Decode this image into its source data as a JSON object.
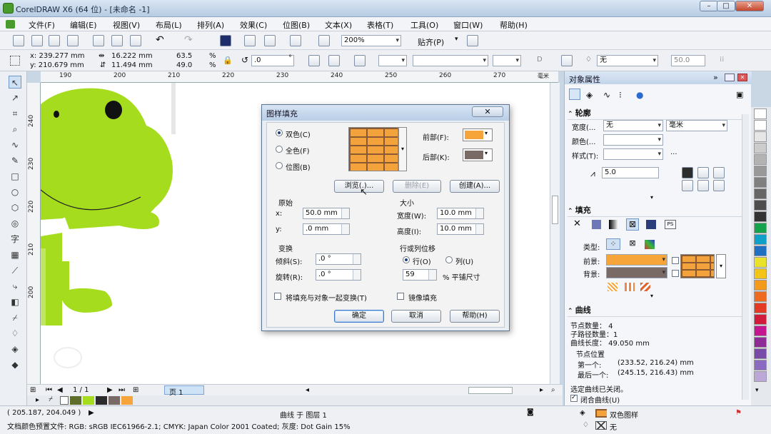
{
  "window": {
    "title": "CorelDRAW X6 (64 位) - [未命名 -1]"
  },
  "menu": [
    "文件(F)",
    "编辑(E)",
    "视图(V)",
    "布局(L)",
    "排列(A)",
    "效果(C)",
    "位图(B)",
    "文本(X)",
    "表格(T)",
    "工具(O)",
    "窗口(W)",
    "帮助(H)"
  ],
  "toolbar1": {
    "zoom": "200%",
    "snap": "贴齐(P)"
  },
  "propbar": {
    "x": "x:  239.277 mm",
    "y": "y:  210.679 mm",
    "w": "16.222 mm",
    "h": "11.494 mm",
    "sx": "63.5",
    "sy": "49.0",
    "pct": "%",
    "angle": ".0",
    "deg": "°",
    "outline": "无",
    "size": "50.0"
  },
  "ruler": {
    "h": [
      "190",
      "200",
      "210",
      "220",
      "230",
      "240",
      "250",
      "260",
      "270",
      "毫米"
    ],
    "v": [
      "240",
      "230",
      "220",
      "210",
      "200"
    ]
  },
  "pagenav": {
    "pages": "1 / 1",
    "tab": "页 1"
  },
  "dialog": {
    "title": "图样填充",
    "r_two": "双色(C)",
    "r_full": "全色(F)",
    "r_bitmap": "位图(B)",
    "fore_label": "前部(F):",
    "back_label": "后部(K):",
    "browse": "浏览(.)...",
    "delete": "删除(E)",
    "create": "创建(A)...",
    "origin": "原始",
    "ox_label": "x:",
    "ox": "50.0 mm",
    "oy_label": "y:",
    "oy": ".0 mm",
    "size": "大小",
    "width_label": "宽度(W):",
    "width": "10.0 mm",
    "height_label": "高度(I):",
    "height": "10.0 mm",
    "transform": "变换",
    "skew_label": "倾斜(S):",
    "skew": ".0 °",
    "rotate_label": "旋转(R):",
    "rotate": ".0 °",
    "offset": "行或列位移",
    "row": "行(O)",
    "col": "列(U)",
    "offset_val": "59",
    "offset_unit": "% 平铺尺寸",
    "chk_transform": "将填充与对象一起变换(T)",
    "chk_mirror": "镜像填充",
    "ok": "确定",
    "cancel": "取消",
    "help": "帮助(H)",
    "fore_color": "#f6a53a",
    "back_color": "#7a6a66"
  },
  "docker": {
    "title": "对象属性",
    "outline_section": "轮廓",
    "ol_width_label": "宽度(...",
    "ol_width": "无",
    "ol_unit": "毫米",
    "ol_color_label": "颜色(...",
    "ol_style_label": "样式(T):",
    "ol_dots": "...",
    "miter": "5.0",
    "fill_section": "填充",
    "fill_type_label": "类型:",
    "fill_fore_label": "前景:",
    "fill_back_label": "背景:",
    "curve_section": "曲线",
    "nodes": "节点数量：  4",
    "subpaths": "子路径数量：1",
    "length": "曲线长度：   49.050 mm",
    "node_pos": "节点位置",
    "first_label": "第一个:",
    "first": "(233.52, 216.24) mm",
    "last_label": "最后一个:",
    "last": "(245.15, 216.43) mm",
    "closed_note": "选定曲线已关闭。",
    "closed_chk": "闭合曲线(U)"
  },
  "status": {
    "coords": "( 205.187, 204.049 )",
    "layer": "曲线 于 图层 1",
    "profile": "文档颜色预置文件: RGB: sRGB IEC61966-2.1; CMYK: Japan Color 2001 Coated; 灰度: Dot Gain 15%",
    "fill_name": "双色图样",
    "outline_name": "无"
  },
  "colors": {
    "frog": "#a6dc1e",
    "accent": "#f6a53a"
  }
}
